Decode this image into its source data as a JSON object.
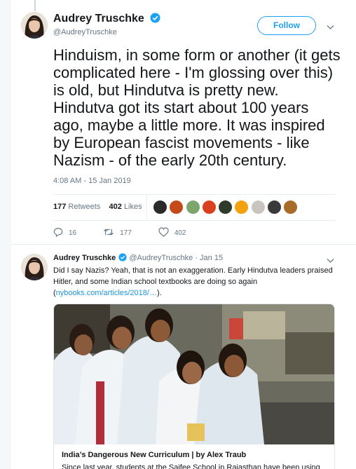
{
  "main_tweet": {
    "author_name": "Audrey Truschke",
    "author_handle": "@AudreyTruschke",
    "follow_label": "Follow",
    "text": "Hinduism, in some form or another (it gets complicated here - I'm glossing over this) is old, but Hindutva is pretty new. Hindutva got its start about 100 years ago, maybe a little more. It was inspired by European fascist movements - like Nazism - of the early 20th century.",
    "timestamp": "4:08 AM - 15 Jan 2019",
    "retweets_count": "177",
    "retweets_label": "Retweets",
    "likes_count": "402",
    "likes_label": "Likes",
    "reply_count": "16",
    "retweet_count": "177",
    "like_count": "402"
  },
  "likers": [
    {
      "icon": "liker-avatar-1",
      "color": "#2b2b2b"
    },
    {
      "icon": "liker-avatar-2",
      "color": "#c44a1a"
    },
    {
      "icon": "liker-avatar-3",
      "color": "#7da66c"
    },
    {
      "icon": "liker-avatar-4",
      "color": "#d9411e"
    },
    {
      "icon": "liker-avatar-5",
      "color": "#2e3b2a"
    },
    {
      "icon": "liker-avatar-6",
      "color": "#f2a20f"
    },
    {
      "icon": "liker-avatar-7",
      "color": "#c9c4bd"
    },
    {
      "icon": "liker-avatar-8",
      "color": "#3a3a3a"
    },
    {
      "icon": "liker-avatar-9",
      "color": "#a86b28"
    }
  ],
  "reply_tweet": {
    "author_name": "Audrey Truschke",
    "author_handle": "@AudreyTruschke",
    "date": "· Jan 15",
    "text_before_link": "Did I say Nazis? Yeah, that is not an exaggeration. Early Hindutva leaders praised Hitler, and some Indian school textbooks are doing so again (",
    "link_text": "nybooks.com/articles/2018/…",
    "text_after_link": ").",
    "card_title": "India’s Dangerous New Curriculum | by Alex Traub",
    "card_description": "Since last year, students at the Saifee School in Rajasthan have been using"
  },
  "colors": {
    "accent": "#1da1f2",
    "link": "#1b95e0",
    "secondary_text": "#657786"
  }
}
